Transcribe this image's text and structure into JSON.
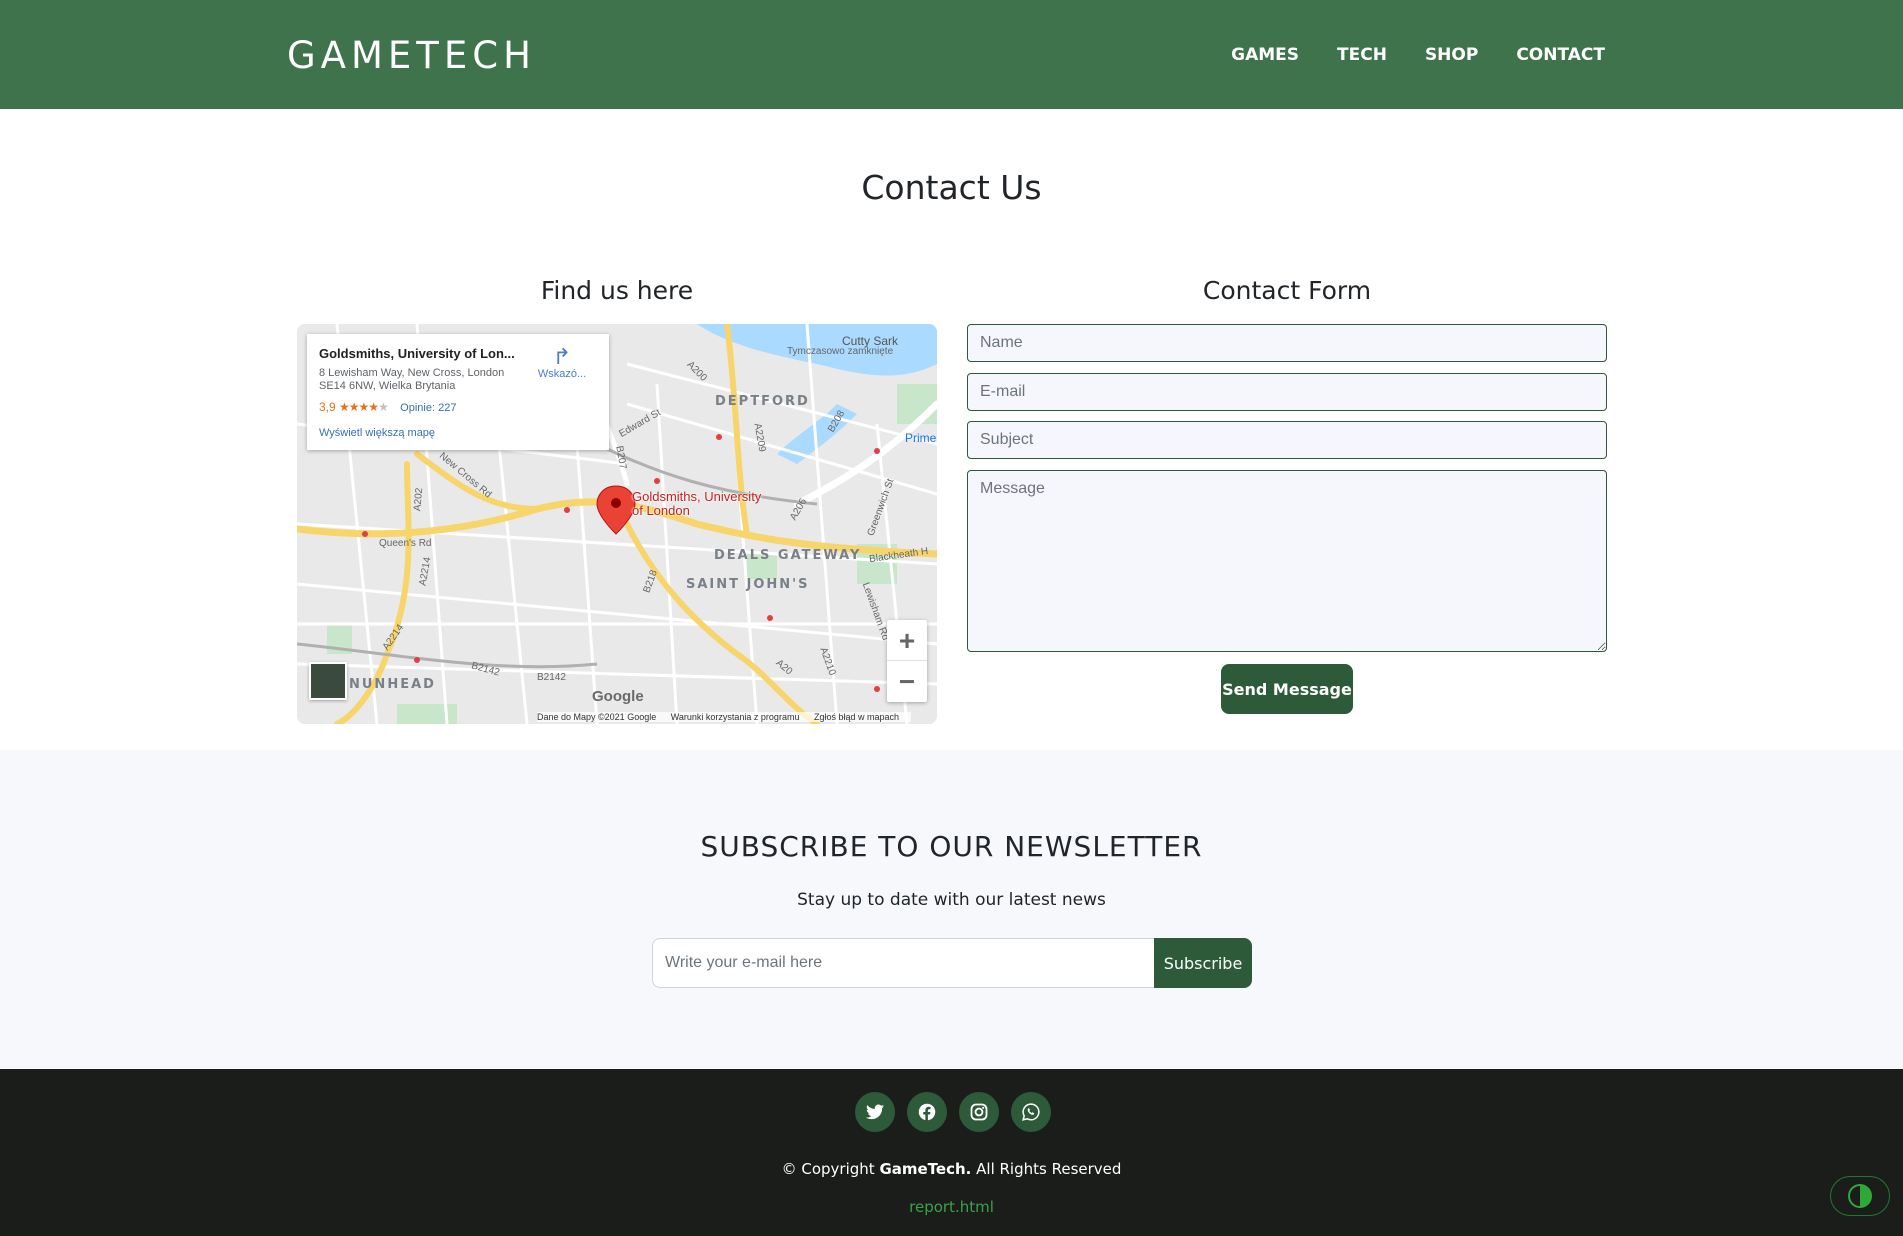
{
  "navbar": {
    "brand": "GAMETECH",
    "links": [
      "GAMES",
      "TECH",
      "SHOP",
      "CONTACT"
    ]
  },
  "page_title": "Contact Us",
  "map_section": {
    "title": "Find us here",
    "card": {
      "place": "Goldsmiths, University of Lon...",
      "address": "8 Lewisham Way, New Cross, London SE14 6NW, Wielka Brytania",
      "rating": "3,9",
      "reviews": "Opinie: 227",
      "directions": "Wskazó...",
      "bigger_map": "Wyświetl większą mapę"
    },
    "pin_label": "Goldsmiths, University of London",
    "area_labels": [
      "DEPTFORD",
      "DEALS GATEWAY",
      "SAINT JOHN'S",
      "NUNHEAD"
    ],
    "road_labels": [
      "New Cross Rd",
      "Queen's Rd",
      "A202",
      "A2214",
      "B218",
      "A2209",
      "A206",
      "B208",
      "A200",
      "Edward St",
      "A20",
      "A2210",
      "B2142",
      "B2142",
      "Greenwich St",
      "Lewisham Rd",
      "Blackheath H",
      "A2214",
      "B207"
    ],
    "poi_labels": [
      "Cutty Sark",
      "Tymczasowo zamknięte",
      "Prime"
    ],
    "google": "Google",
    "footer": [
      "Dane do Mapy ©2021 Google",
      "Warunki korzystania z programu",
      "Zgłoś błąd w mapach"
    ]
  },
  "contact_form": {
    "title": "Contact Form",
    "name_placeholder": "Name",
    "email_placeholder": "E-mail",
    "subject_placeholder": "Subject",
    "message_placeholder": "Message",
    "send_label": "Send Message"
  },
  "newsletter": {
    "title": "SUBSCRIBE TO OUR NEWSLETTER",
    "subtitle": "Stay up to date with our latest news",
    "input_placeholder": "Write your e-mail here",
    "button_label": "Subscribe"
  },
  "footer": {
    "social_icons": [
      "twitter-icon",
      "facebook-icon",
      "instagram-icon",
      "whatsapp-icon"
    ],
    "copyright_prefix": "© Copyright",
    "copyright_brand": "GameTech.",
    "copyright_suffix": "All Rights Reserved",
    "report_link": "report.html"
  },
  "colors": {
    "navbar": "#3f734c",
    "accent": "#2d5b39",
    "footer": "#1b1d1b",
    "newsletter_bg": "#f6f8fc",
    "link_green": "#3aa24a"
  }
}
